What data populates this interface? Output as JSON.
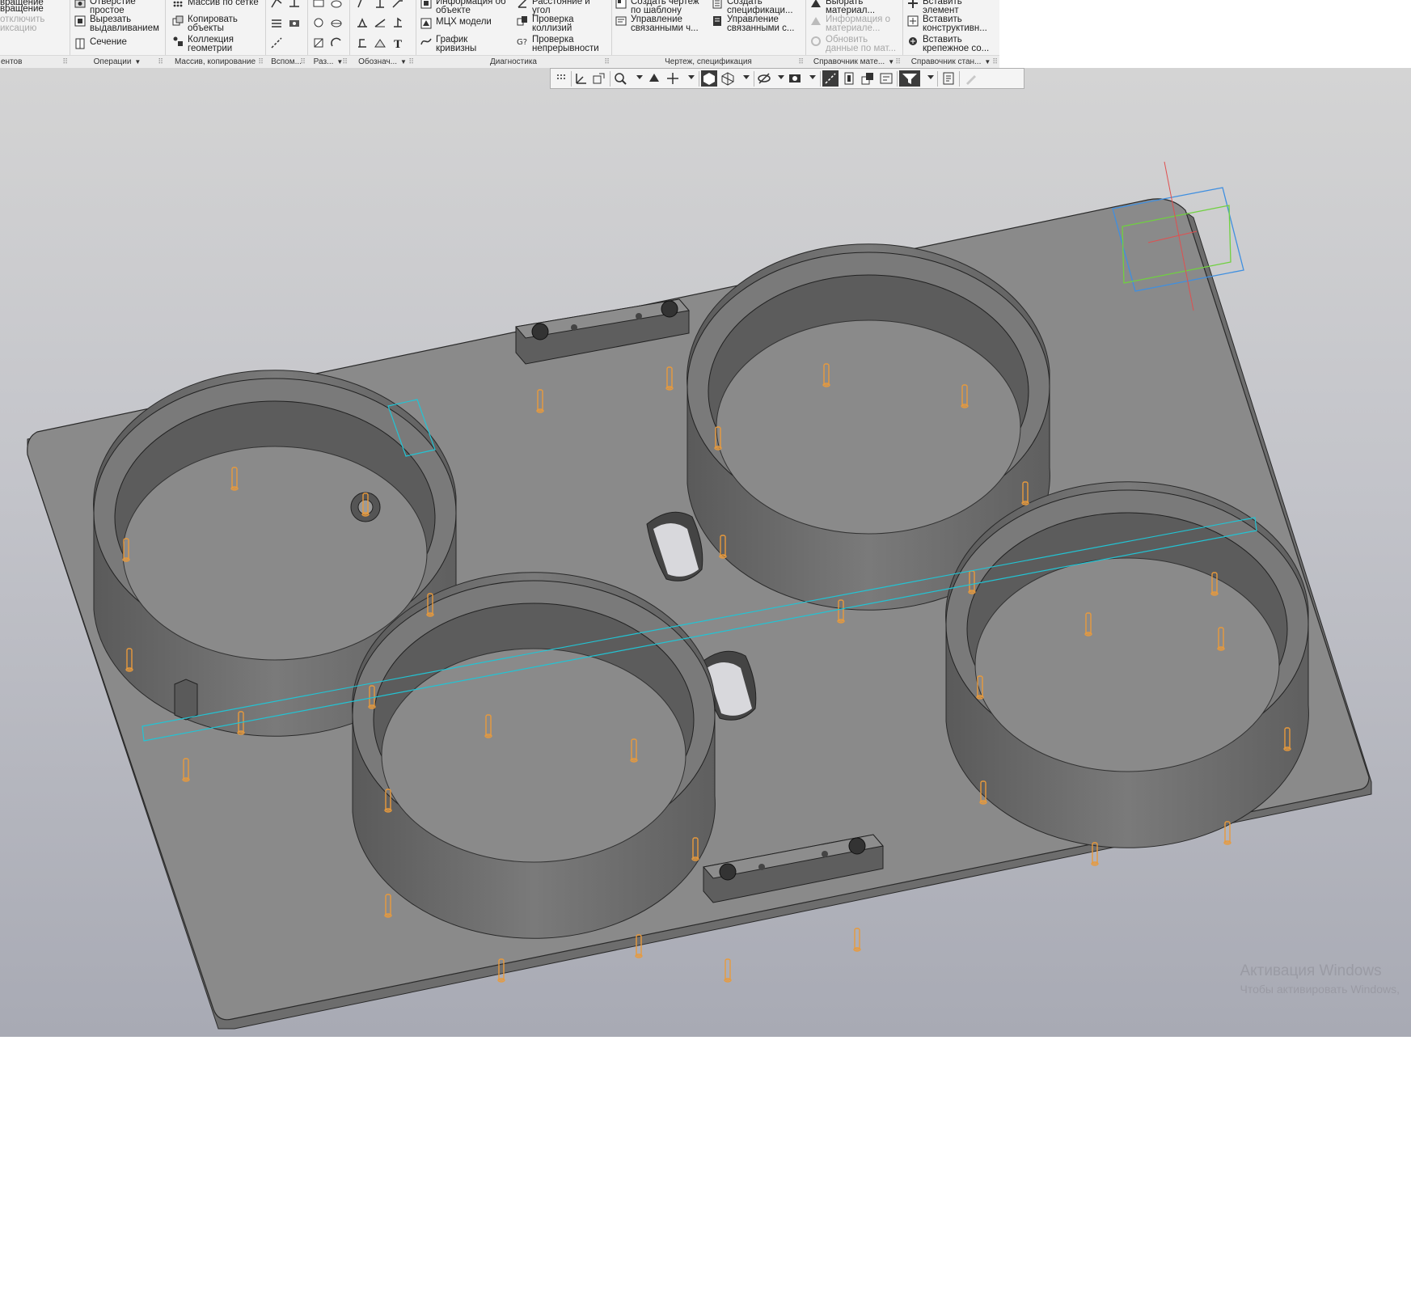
{
  "ribbon": {
    "groups": [
      {
        "label": "ентов",
        "items": [
          "вращение",
          "вращение",
          "отключить",
          "иксацию"
        ]
      },
      {
        "label": "Операции",
        "items": [
          "Отверстие простое",
          "Вырезать выдавливанием",
          "Сечение"
        ]
      },
      {
        "label": "Массив, копирование",
        "items": [
          "Массив по сетке",
          "Копировать объекты",
          "Коллекция геометрии"
        ]
      },
      {
        "label": "Вспом..."
      },
      {
        "label": "Раз..."
      },
      {
        "label": "Обознач..."
      },
      {
        "label": "Диагностика",
        "items": [
          "Информация об объекте",
          "МЦХ модели",
          "График кривизны",
          "Расстояние и угол",
          "Проверка коллизий",
          "Проверка непрерывности"
        ]
      },
      {
        "label": "Чертеж, спецификация",
        "items": [
          "Создать чертеж по шаблону",
          "Управление связанными ч...",
          "Создать спецификаци...",
          "Управление связанными с..."
        ]
      },
      {
        "label": "Справочник мате...",
        "items": [
          "Выбрать материал...",
          "Информация о материале...",
          "Обновить данные по мат..."
        ]
      },
      {
        "label": "Справочник стан...",
        "items": [
          "Вставить элемент",
          "Вставить конструктивн...",
          "Вставить крепежное со..."
        ]
      }
    ]
  },
  "view_toolbar": {
    "buttons": [
      "grid-icon",
      "orient-icon",
      "orient-select-icon",
      "zoom-icon",
      "rotate-icon",
      "pan-icon",
      "shaded-edges-icon",
      "wireframe-icon",
      "hide-icon",
      "view-camera-icon",
      "snap-icon",
      "section-icon",
      "layers-icon",
      "display-icon",
      "filter-icon",
      "properties-icon",
      "pencil-icon"
    ],
    "active": [
      "shaded-edges-icon",
      "snap-icon",
      "filter-icon"
    ]
  },
  "model": {
    "plate_color": "#8a8a8a",
    "ring_color": "#6f6f6f",
    "pin_color": "#e89a3c",
    "plane_color": "#22c4d4",
    "axis_colors": {
      "x": "#e05050",
      "y": "#70d040",
      "z": "#3f8fe0"
    }
  },
  "watermark": {
    "title": "Активация Windows",
    "subtitle": "Чтобы активировать Windows,"
  }
}
